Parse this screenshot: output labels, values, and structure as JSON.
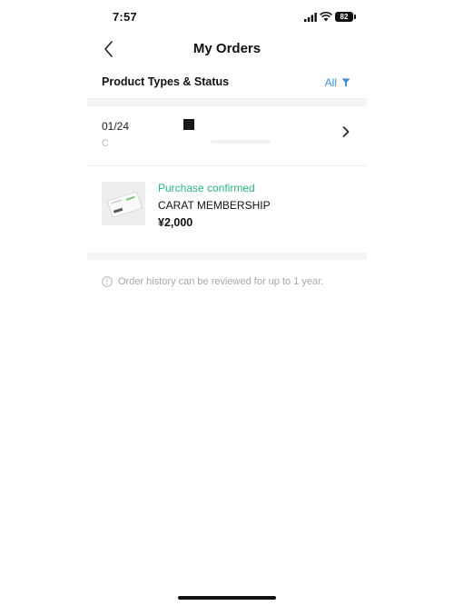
{
  "status_bar": {
    "time": "7:57",
    "battery": "82",
    "icons": [
      "signal-icon",
      "wifi-icon",
      "battery-icon"
    ]
  },
  "header": {
    "title": "My Orders",
    "back_icon": "chevron-left-icon"
  },
  "filter": {
    "label": "Product Types & Status",
    "value": "All",
    "icon": "filter-icon",
    "accent_color": "#3a8fd6"
  },
  "order": {
    "date": "01/24",
    "order_number": "C",
    "chevron_icon": "chevron-right-icon",
    "items": [
      {
        "status": "Purchase confirmed",
        "status_color": "#2ab57d",
        "name": "CARAT MEMBERSHIP",
        "price": "¥2,000"
      }
    ]
  },
  "notice": {
    "icon": "info-icon",
    "text": "Order history can be reviewed for up to 1 year."
  }
}
